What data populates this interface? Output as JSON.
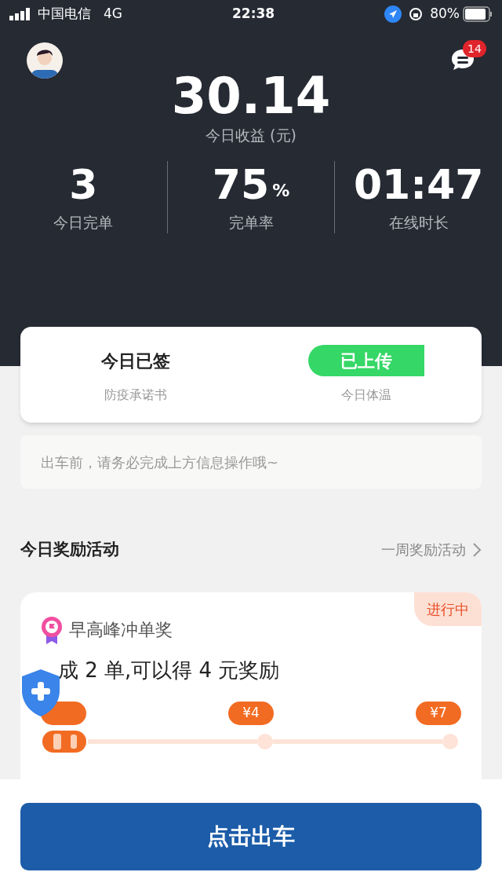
{
  "status_bar": {
    "carrier": "中国电信",
    "network": "4G",
    "time": "22:38",
    "battery": "80%"
  },
  "header": {
    "badge": "14"
  },
  "earnings": {
    "amount": "30.14",
    "label": "今日收益 (元)"
  },
  "stats": [
    {
      "value": "3",
      "label": "今日完单"
    },
    {
      "value": "75",
      "unit": "%",
      "label": "完单率"
    },
    {
      "value": "01:47",
      "label": "在线时长"
    }
  ],
  "checks": [
    {
      "kind": "text",
      "value": "今日已签",
      "label": "防疫承诺书"
    },
    {
      "kind": "pill",
      "value": "已上传",
      "label": "今日体温"
    }
  ],
  "notice": "出车前，请务必完成上方信息操作哦~",
  "rewards": {
    "title": "今日奖励活动",
    "link": "一周奖励活动",
    "card": {
      "status": "进行中",
      "name": "早高峰冲单奖",
      "goal": "成 2 单,可以得 4 元奖励",
      "milestones": [
        {
          "label": "¥4"
        },
        {
          "label": "¥7"
        }
      ]
    }
  },
  "action": "点击出车"
}
